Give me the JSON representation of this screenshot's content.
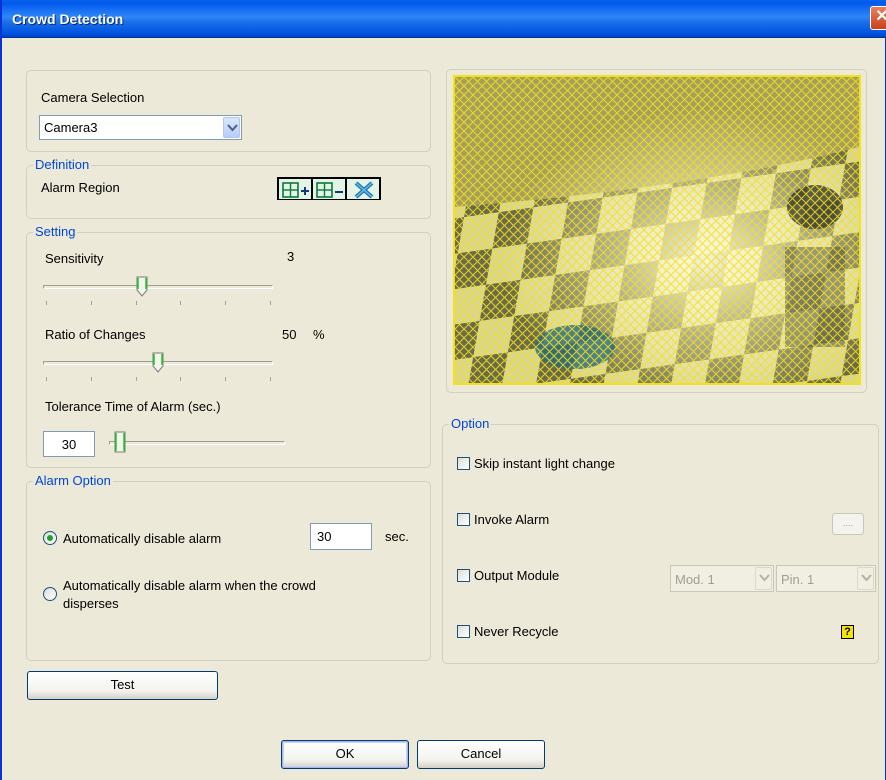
{
  "window": {
    "title": "Crowd Detection",
    "close_label": "✕"
  },
  "camera_selection": {
    "label": "Camera Selection",
    "selected": "Camera3"
  },
  "definition": {
    "legend": "Definition",
    "alarm_region_label": "Alarm Region",
    "tools": [
      {
        "name": "add-region-icon"
      },
      {
        "name": "remove-region-icon"
      },
      {
        "name": "clear-region-icon"
      }
    ]
  },
  "setting": {
    "legend": "Setting",
    "sensitivity": {
      "label": "Sensitivity",
      "value": "3",
      "level": 3,
      "min": 0,
      "max": 7
    },
    "ratio": {
      "label": "Ratio of Changes",
      "value": "50",
      "unit": "%",
      "level": 50,
      "min": 0,
      "max": 100
    },
    "tolerance": {
      "label": "Tolerance Time of Alarm (sec.)",
      "value": "30",
      "level": 0.03
    }
  },
  "alarm_option": {
    "legend": "Alarm Option",
    "auto_disable": {
      "label": "Automatically disable alarm",
      "value": "30",
      "unit": "sec.",
      "selected": true
    },
    "disperse": {
      "label_line1": "Automatically disable alarm when the crowd",
      "label_line2": "disperses",
      "selected": false
    }
  },
  "option": {
    "legend": "Option",
    "skip_light": {
      "label": "Skip instant light change",
      "checked": false
    },
    "invoke_alarm": {
      "label": "Invoke Alarm",
      "checked": false,
      "button": "...."
    },
    "output_module": {
      "label": "Output Module",
      "checked": false,
      "module": "Mod. 1",
      "pin": "Pin. 1"
    },
    "never_recycle": {
      "label": "Never Recycle",
      "checked": false
    },
    "help_icon": "?"
  },
  "buttons": {
    "test": "Test",
    "ok": "OK",
    "cancel": "Cancel"
  },
  "colors": {
    "title_bar": "#0054e3",
    "legend": "#0046d5",
    "region_overlay": "#f2e21a"
  }
}
